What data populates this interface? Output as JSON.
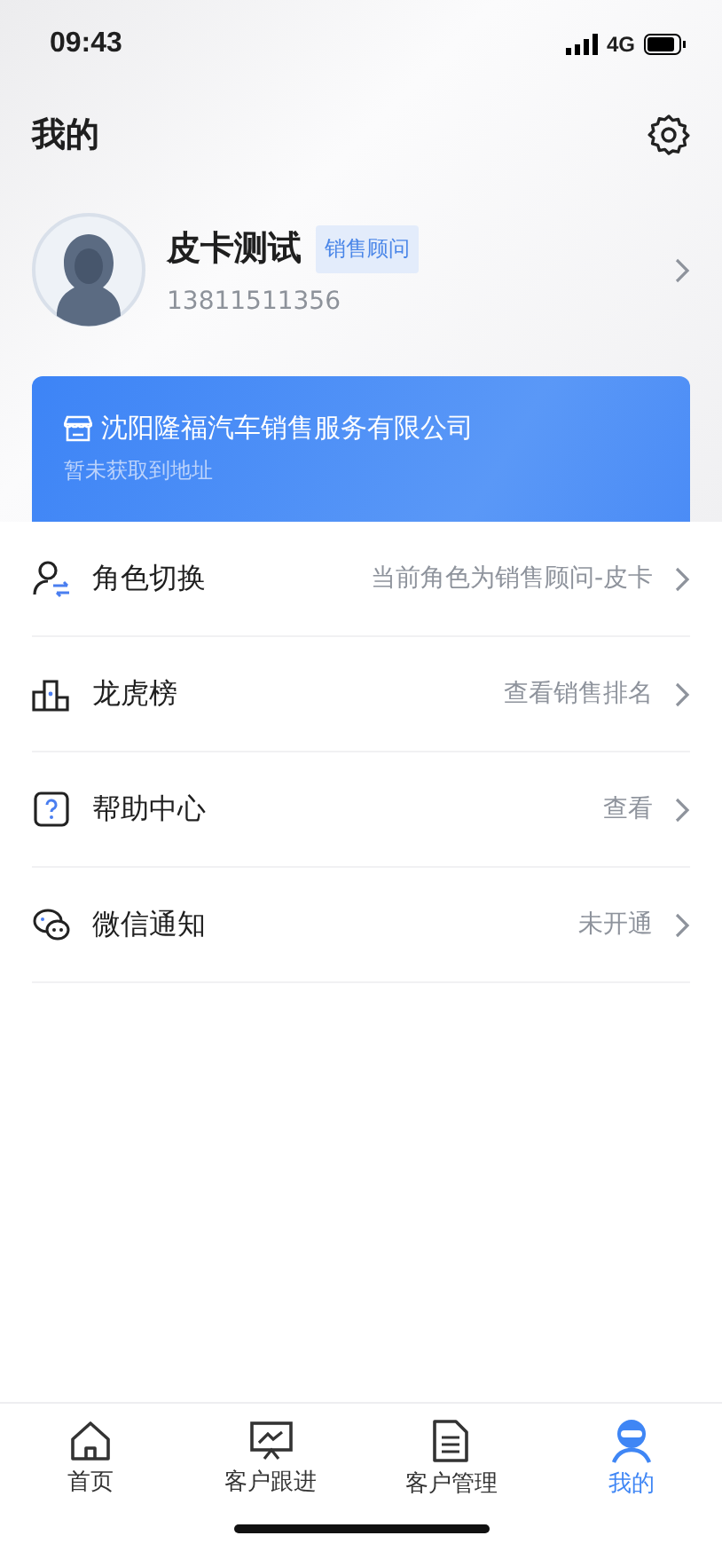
{
  "status_bar": {
    "time": "09:43",
    "network": "4G"
  },
  "header": {
    "title": "我的"
  },
  "profile": {
    "name": "皮卡测试",
    "role": "销售顾问",
    "phone": "13811511356"
  },
  "company_card": {
    "name": "沈阳隆福汽车销售服务有限公司",
    "address": "暂未获取到地址"
  },
  "menu": [
    {
      "kind": "role",
      "label": "角色切换",
      "value": "当前角色为销售顾问-皮卡"
    },
    {
      "kind": "ranking",
      "label": "龙虎榜",
      "value": "查看销售排名"
    },
    {
      "kind": "help",
      "label": "帮助中心",
      "value": "查看"
    },
    {
      "kind": "wechat",
      "label": "微信通知",
      "value": "未开通"
    }
  ],
  "tab_bar": [
    {
      "kind": "home",
      "label": "首页",
      "selected": false
    },
    {
      "kind": "chart",
      "label": "客户跟进",
      "selected": false
    },
    {
      "kind": "doc",
      "label": "客户管理",
      "selected": false
    },
    {
      "kind": "user",
      "label": "我的",
      "selected": true
    }
  ]
}
